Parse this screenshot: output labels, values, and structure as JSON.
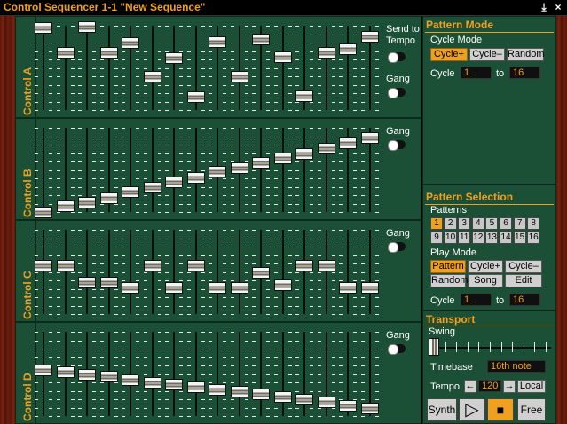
{
  "window": {
    "title": "Control Sequencer 1-1 \"New Sequence\"",
    "pin_icon": "⤓",
    "close_icon": "×"
  },
  "controls": [
    {
      "label": "Control A",
      "send_to_tempo_label": "Send to Tempo",
      "gang_label": "Gang",
      "values": [
        0.98,
        0.68,
        0.99,
        0.68,
        0.8,
        0.4,
        0.62,
        0.16,
        0.81,
        0.4,
        0.84,
        0.63,
        0.17,
        0.68,
        0.73,
        0.87
      ]
    },
    {
      "label": "Control B",
      "gang_label": "Gang",
      "values": [
        0.0,
        0.07,
        0.12,
        0.17,
        0.24,
        0.3,
        0.36,
        0.41,
        0.48,
        0.53,
        0.59,
        0.64,
        0.7,
        0.76,
        0.82,
        0.88
      ]
    },
    {
      "label": "Control C",
      "gang_label": "Gang",
      "values": [
        0.58,
        0.58,
        0.38,
        0.38,
        0.32,
        0.58,
        0.32,
        0.58,
        0.32,
        0.32,
        0.5,
        0.35,
        0.58,
        0.58,
        0.32,
        0.32
      ]
    },
    {
      "label": "Control D",
      "gang_label": "Gang",
      "values": [
        0.55,
        0.53,
        0.5,
        0.47,
        0.43,
        0.4,
        0.38,
        0.35,
        0.32,
        0.29,
        0.26,
        0.23,
        0.2,
        0.17,
        0.13,
        0.1
      ]
    }
  ],
  "pattern_mode": {
    "title": "Pattern Mode",
    "cycle_mode_label": "Cycle Mode",
    "buttons": [
      "Cycle+",
      "Cycle–",
      "Random"
    ],
    "active": "Cycle+",
    "cycle_label": "Cycle",
    "cycle_from": "1",
    "to_label": "to",
    "cycle_to": "16"
  },
  "pattern_selection": {
    "title": "Pattern Selection",
    "patterns_label": "Patterns",
    "patterns": [
      "1",
      "2",
      "3",
      "4",
      "5",
      "6",
      "7",
      "8",
      "9",
      "10",
      "11",
      "12",
      "13",
      "14",
      "15",
      "16"
    ],
    "active_pattern": "1",
    "play_mode_label": "Play Mode",
    "play_modes": [
      "Pattern",
      "Cycle+",
      "Cycle–",
      "Random",
      "Song",
      "Edit"
    ],
    "active_play_mode": "Pattern",
    "cycle_label": "Cycle",
    "cycle_from": "1",
    "to_label": "to",
    "cycle_to": "16"
  },
  "transport": {
    "title": "Transport",
    "swing_label": "Swing",
    "swing_value": 0.0,
    "timebase_label": "Timebase",
    "timebase_value": "16th note",
    "tempo_label": "Tempo",
    "tempo_dec": "←",
    "tempo_value": "120",
    "tempo_inc": "→",
    "local_label": "Local",
    "synth_label": "Synth",
    "play_icon": "▷",
    "stop_icon": "■",
    "free_label": "Free"
  },
  "colors": {
    "accent": "#f0a020",
    "panel": "#1c5036"
  }
}
